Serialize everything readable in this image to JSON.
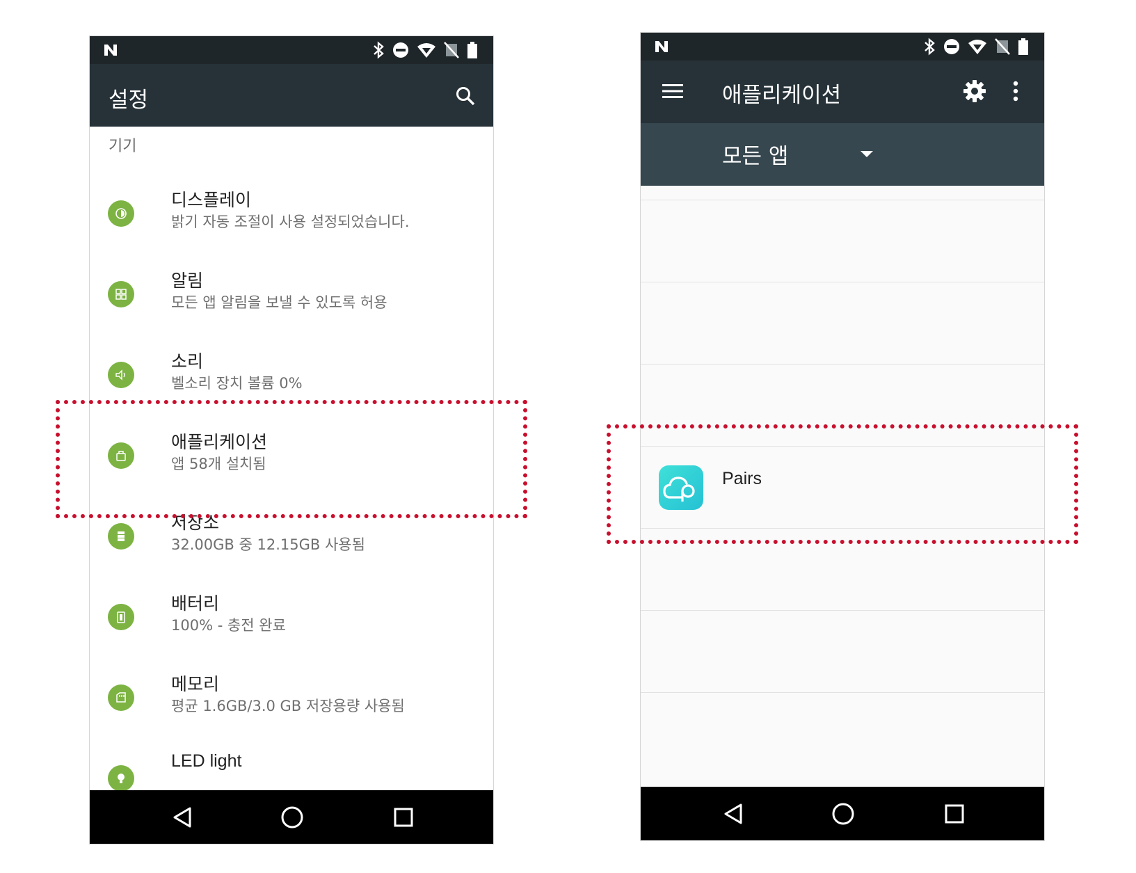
{
  "left_screen": {
    "title": "설정",
    "section_header": "기기",
    "items": [
      {
        "title": "디스플레이",
        "subtitle": "밝기 자동 조절이 사용 설정되었습니다.",
        "icon": "display-icon"
      },
      {
        "title": "알림",
        "subtitle": "모든 앱 알림을 보낼 수 있도록 허용",
        "icon": "notifications-icon"
      },
      {
        "title": "소리",
        "subtitle": "벨소리 장치 볼륨 0%",
        "icon": "sound-icon"
      },
      {
        "title": "애플리케이션",
        "subtitle": "앱 58개 설치됨",
        "icon": "apps-icon"
      },
      {
        "title": "저장소",
        "subtitle": "32.00GB 중 12.15GB 사용됨",
        "icon": "storage-icon"
      },
      {
        "title": "배터리",
        "subtitle": "100% - 충전 완료",
        "icon": "battery-icon"
      },
      {
        "title": "메모리",
        "subtitle": "평균 1.6GB/3.0 GB 저장용량 사용됨",
        "icon": "memory-icon"
      },
      {
        "title": "LED light",
        "subtitle": "",
        "icon": "bulb-icon"
      }
    ]
  },
  "right_screen": {
    "title": "애플리케이션",
    "dropdown_label": "모든 앱",
    "apps": [
      {
        "name": "Pairs"
      }
    ]
  },
  "colors": {
    "appbar": "#263238",
    "subbar": "#37474f",
    "statusbar": "#1f262a",
    "setting_icon": "#7cb342",
    "highlight": "#c8102e",
    "app_icon": "#2fd0d6"
  }
}
